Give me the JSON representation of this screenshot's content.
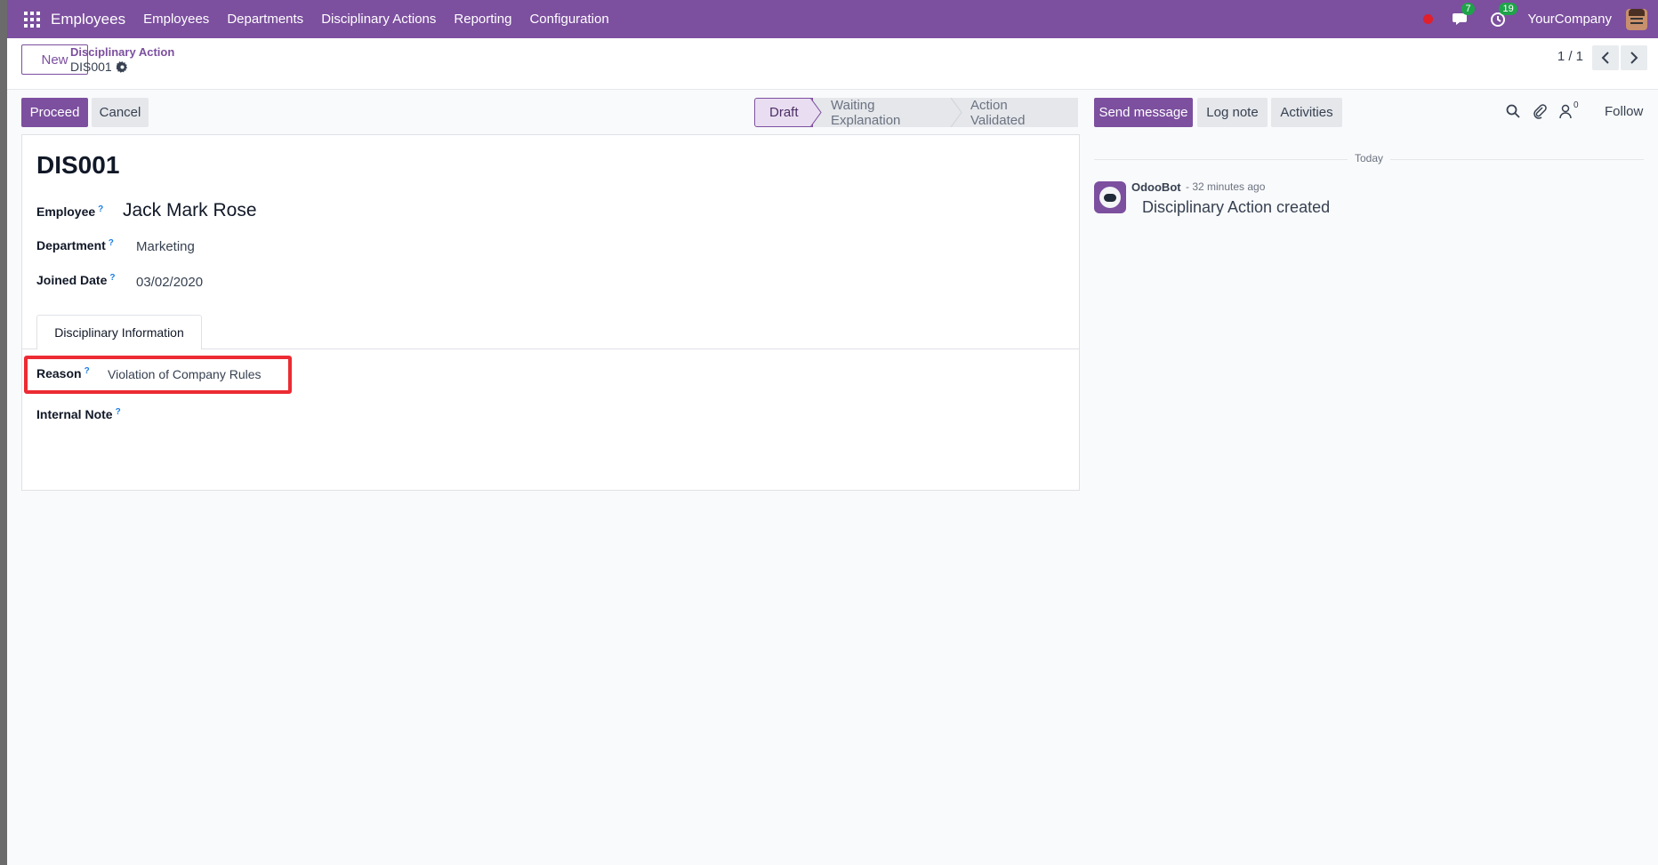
{
  "navbar": {
    "brand": "Employees",
    "menu": [
      "Employees",
      "Departments",
      "Disciplinary Actions",
      "Reporting",
      "Configuration"
    ],
    "messages_badge": "7",
    "activities_badge": "19",
    "company": "YourCompany"
  },
  "control": {
    "new_label": "New",
    "breadcrumb_parent": "Disciplinary Action",
    "breadcrumb_current": "DIS001",
    "pager": "1 / 1"
  },
  "actions": {
    "proceed": "Proceed",
    "cancel": "Cancel"
  },
  "status": {
    "stages": [
      "Draft",
      "Waiting Explanation",
      "Action Validated"
    ],
    "current": "Draft"
  },
  "form": {
    "title": "DIS001",
    "employee_label": "Employee",
    "employee_value": "Jack Mark Rose",
    "department_label": "Department",
    "department_value": "Marketing",
    "joined_label": "Joined Date",
    "joined_value": "03/02/2020",
    "tab_label": "Disciplinary Information",
    "reason_label": "Reason",
    "reason_value": "Violation of Company Rules",
    "note_label": "Internal Note",
    "help_mark": "?"
  },
  "chatter": {
    "send_message": "Send message",
    "log_note": "Log note",
    "activities": "Activities",
    "followers_count": "0",
    "follow": "Follow",
    "date_separator": "Today",
    "messages": [
      {
        "author": "OdooBot",
        "time": "- 32 minutes ago",
        "body": "Disciplinary Action created"
      }
    ]
  },
  "colors": {
    "brand": "#7c4f9f",
    "highlight": "#ec2b33",
    "badge": "#1fa34a"
  }
}
